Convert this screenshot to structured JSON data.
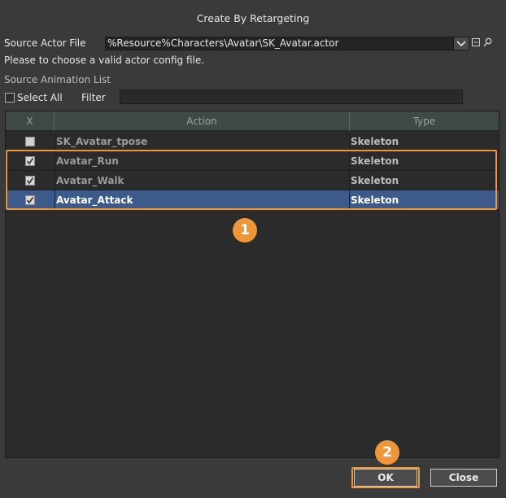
{
  "dialog": {
    "title": "Create By Retargeting"
  },
  "source": {
    "label": "Source Actor File",
    "value": "%Resource%Characters\\Avatar\\SK_Avatar.actor",
    "hint": "Please to choose a valid actor config file."
  },
  "anim_list": {
    "label": "Source Animation List",
    "select_all_label": "Select All",
    "filter_label": "Filter",
    "filter_value": ""
  },
  "table": {
    "columns": [
      "X",
      "Action",
      "Type"
    ],
    "rows": [
      {
        "checked": false,
        "action": "SK_Avatar_tpose",
        "type": "Skeleton",
        "selected": false
      },
      {
        "checked": true,
        "action": "Avatar_Run",
        "type": "Skeleton",
        "selected": false
      },
      {
        "checked": true,
        "action": "Avatar_Walk",
        "type": "Skeleton",
        "selected": false
      },
      {
        "checked": true,
        "action": "Avatar_Attack",
        "type": "Skeleton",
        "selected": true
      }
    ]
  },
  "annotations": {
    "badge1": "1",
    "badge2": "2"
  },
  "buttons": {
    "ok": "OK",
    "close": "Close"
  },
  "colors": {
    "highlight": "#f0963a",
    "selection": "#3d5a8a",
    "header": "#3f4a44"
  },
  "icons": [
    "chevron-down-icon",
    "more-icon",
    "search-icon",
    "checkmark-icon"
  ]
}
